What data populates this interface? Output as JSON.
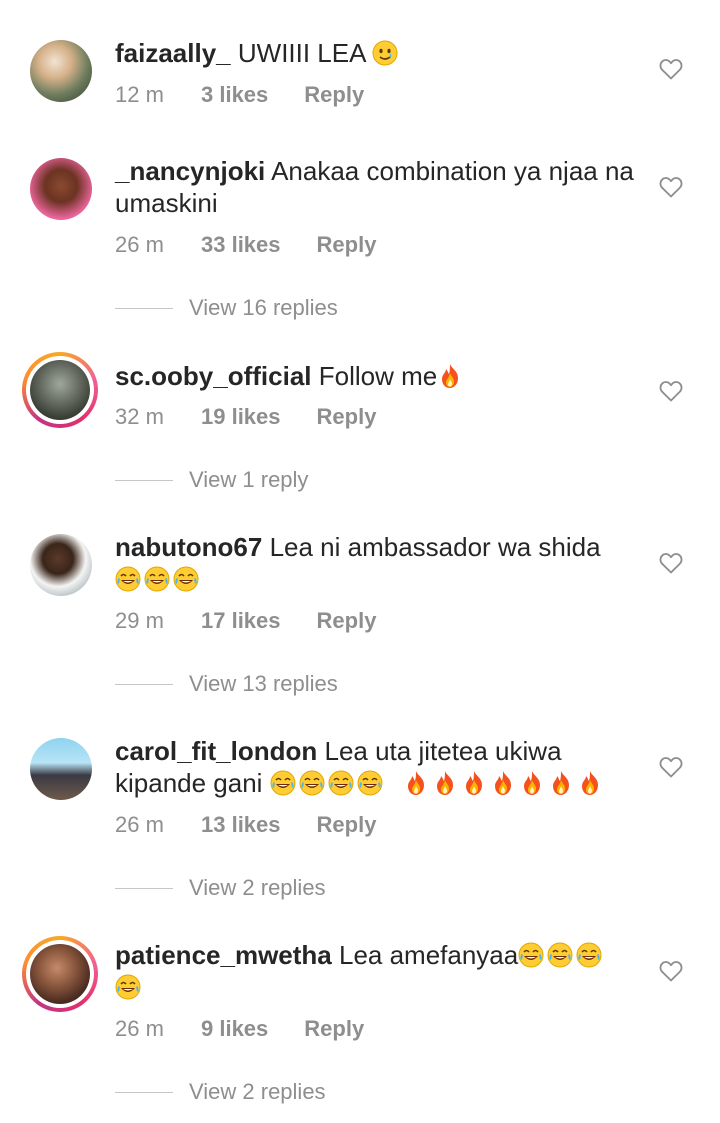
{
  "comments": [
    {
      "username": "faizaally_",
      "text": "UWIIII LEA",
      "emojis": [
        "tear-smile"
      ],
      "time": "12 m",
      "likes": "3 likes",
      "reply": "Reply",
      "story_ring": false
    },
    {
      "username": "_nancynjoki",
      "text": "Anakaa combination ya njaa na umaskini",
      "emojis": [],
      "time": "26 m",
      "likes": "33 likes",
      "reply": "Reply",
      "story_ring": false,
      "view_replies": "View 16 replies"
    },
    {
      "username": "sc.ooby_official",
      "text": "Follow me",
      "emojis": [
        "fire"
      ],
      "time": "32 m",
      "likes": "19 likes",
      "reply": "Reply",
      "story_ring": true,
      "view_replies": "View 1 reply"
    },
    {
      "username": "nabutono67",
      "text": "Lea ni ambassador wa shida",
      "emojis": [
        "joy",
        "joy",
        "joy"
      ],
      "time": "29 m",
      "likes": "17 likes",
      "reply": "Reply",
      "story_ring": false,
      "view_replies": "View 13 replies"
    },
    {
      "username": "carol_fit_london",
      "text": "Lea uta  jitetea ukiwa kipande gani",
      "emojis": [
        "joy",
        "joy",
        "joy",
        "joy",
        "fire",
        "fire",
        "fire",
        "fire",
        "fire",
        "fire",
        "fire"
      ],
      "time": "26 m",
      "likes": "13 likes",
      "reply": "Reply",
      "story_ring": false,
      "view_replies": "View 2 replies"
    },
    {
      "username": "patience_mwetha",
      "text": "Lea amefanyaa",
      "emojis": [
        "joy",
        "joy",
        "joy",
        "joy"
      ],
      "time": "26 m",
      "likes": "9 likes",
      "reply": "Reply",
      "story_ring": true,
      "view_replies": "View 2 replies"
    }
  ],
  "icons": {
    "like": "heart-outline-icon",
    "tear_smile": "smiling-face-with-tear-icon",
    "joy": "face-with-tears-of-joy-icon",
    "fire": "fire-icon"
  },
  "colors": {
    "text": "#262626",
    "secondary": "#8e8e8e",
    "divider": "#c7c7c7",
    "ring_start": "#f9a825",
    "ring_end": "#c13584"
  }
}
